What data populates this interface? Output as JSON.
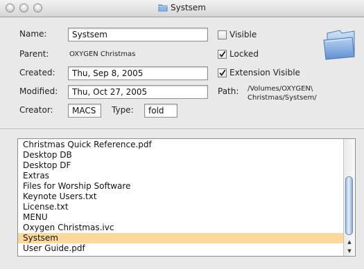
{
  "window": {
    "title": "Systsem"
  },
  "labels": {
    "name": "Name:",
    "parent": "Parent:",
    "created": "Created:",
    "modified": "Modified:",
    "creator": "Creator:",
    "type": "Type:",
    "path": "Path:"
  },
  "values": {
    "name": "Systsem",
    "parent": "OXYGEN Christmas",
    "created": "Thu, Sep 8, 2005",
    "modified": "Thu, Oct 27, 2005",
    "creator": "MACS",
    "type": "fold",
    "path_line1": "/Volumes/OXYGEN\\",
    "path_line2": "Christmas/Systsem/"
  },
  "checkboxes": [
    {
      "label": "Visible",
      "checked": false
    },
    {
      "label": "Locked",
      "checked": true
    },
    {
      "label": "Extension Visible",
      "checked": true
    }
  ],
  "files": [
    "Christmas Quick Reference.pdf",
    "Desktop DB",
    "Desktop DF",
    "Extras",
    "Files for Worship Software",
    "Keynote Users.txt",
    "License.txt",
    "MENU",
    "Oxygen Christmas.ivc",
    "Systsem",
    "User Guide.pdf"
  ],
  "selected_file": "Systsem",
  "icons": [
    "close-button",
    "minimize-button",
    "zoom-button",
    "folder-icon",
    "checkmark-icon",
    "scroll-up-arrow-icon",
    "scroll-down-arrow-icon"
  ],
  "colors": {
    "selection": "#fcd99b",
    "folder": "#8fb6e8"
  }
}
